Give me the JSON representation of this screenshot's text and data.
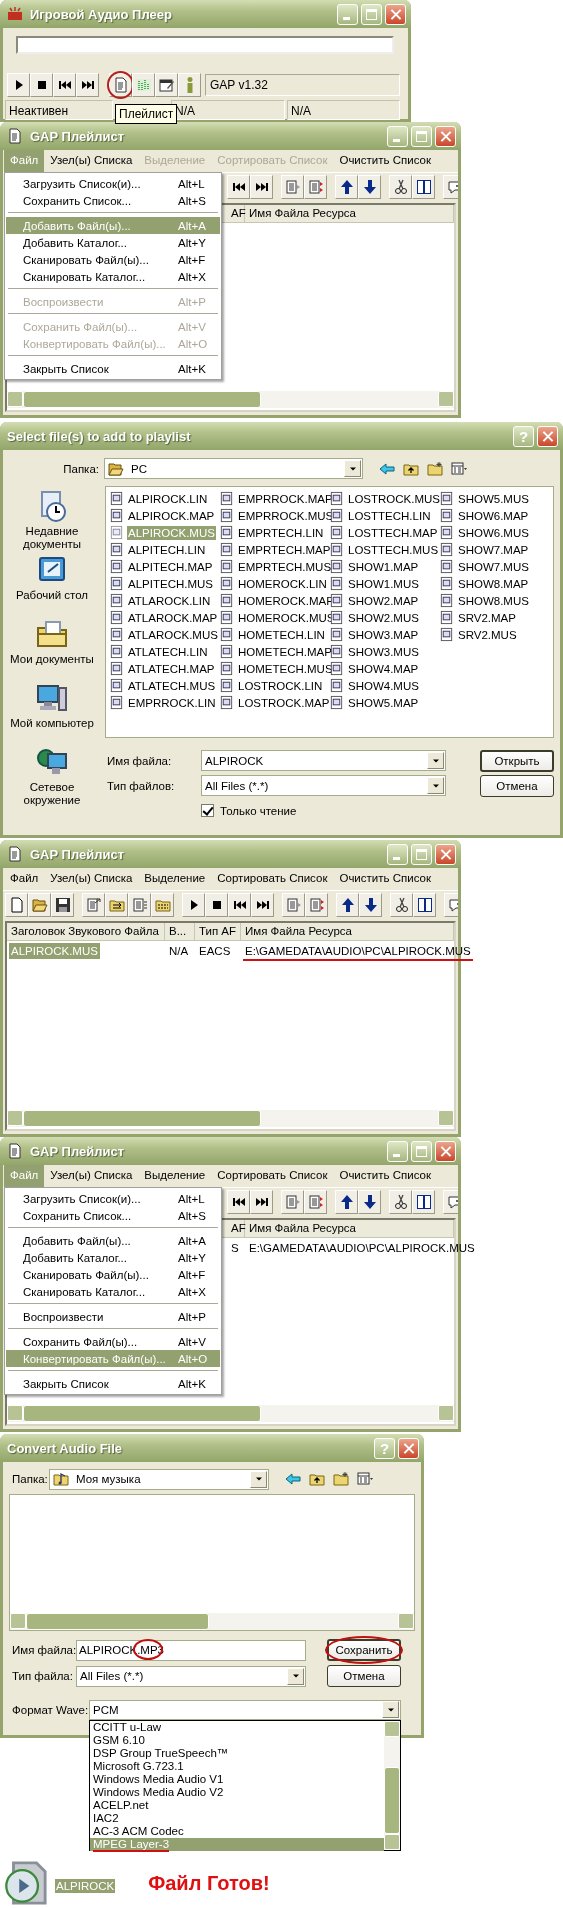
{
  "screens": [
    {
      "kind": "player",
      "title": "Игровой Аудио Плеер",
      "buttons": [
        {
          "kind": "play",
          "annotated": false
        },
        {
          "kind": "stop",
          "annotated": false
        },
        {
          "kind": "prev",
          "annotated": false
        },
        {
          "kind": "next",
          "annotated": false
        },
        {
          "kind": "playlist",
          "annotated": true
        },
        {
          "kind": "eq",
          "annotated": false
        },
        {
          "kind": "settings",
          "annotated": false
        },
        {
          "kind": "info",
          "annotated": false
        }
      ],
      "version": "GAP v1.32",
      "status": [
        "Неактивен",
        "N/A",
        "N/A"
      ],
      "tooltip": "Плейлист"
    },
    {
      "kind": "playlist",
      "title": "GAP Плейлист",
      "menubar": [
        {
          "label": "Файл",
          "open": true,
          "disabled": false
        },
        {
          "label": "Узел(ы) Списка",
          "open": false,
          "disabled": false
        },
        {
          "label": "Выделение",
          "open": false,
          "disabled": true
        },
        {
          "label": "Сортировать Список",
          "open": false,
          "disabled": true
        },
        {
          "label": "Очистить Список",
          "open": false,
          "disabled": false
        }
      ],
      "menu": [
        {
          "kind": "item",
          "label": "Загрузить Список(и)...",
          "shortcut": "Alt+L",
          "disabled": false,
          "selected": false
        },
        {
          "kind": "item",
          "label": "Сохранить Список...",
          "shortcut": "Alt+S",
          "disabled": false,
          "selected": false
        },
        {
          "kind": "separator"
        },
        {
          "kind": "item",
          "label": "Добавить Файл(ы)...",
          "shortcut": "Alt+A",
          "disabled": false,
          "selected": true
        },
        {
          "kind": "item",
          "label": "Добавить Каталог...",
          "shortcut": "Alt+Y",
          "disabled": false,
          "selected": false
        },
        {
          "kind": "item",
          "label": "Сканировать Файл(ы)...",
          "shortcut": "Alt+F",
          "disabled": false,
          "selected": false
        },
        {
          "kind": "item",
          "label": "Сканировать Каталог...",
          "shortcut": "Alt+X",
          "disabled": false,
          "selected": false
        },
        {
          "kind": "separator"
        },
        {
          "kind": "item",
          "label": "Воспроизвести",
          "shortcut": "Alt+P",
          "disabled": true,
          "selected": false
        },
        {
          "kind": "separator"
        },
        {
          "kind": "item",
          "label": "Сохранить Файл(ы)...",
          "shortcut": "Alt+V",
          "disabled": true,
          "selected": false
        },
        {
          "kind": "item",
          "label": "Конвертировать Файл(ы)...",
          "shortcut": "Alt+O",
          "disabled": true,
          "selected": false
        },
        {
          "kind": "separator"
        },
        {
          "kind": "item",
          "label": "Закрыть Список",
          "shortcut": "Alt+K",
          "disabled": false,
          "selected": false
        }
      ],
      "columns": [
        {
          "label": "AF"
        },
        {
          "label": "Имя Файла Ресурса"
        }
      ]
    },
    {
      "kind": "file_dialog",
      "title": "Select file(s) to add to playlist",
      "help": "?",
      "folder_label": "Папка:",
      "folder": "PC",
      "places": [
        {
          "kind": "recent",
          "label": "Недавние документы"
        },
        {
          "kind": "desktop",
          "label": "Рабочий стол"
        },
        {
          "kind": "documents",
          "label": "Мои документы"
        },
        {
          "kind": "computer",
          "label": "Мой компьютер"
        },
        {
          "kind": "network",
          "label": "Сетевое окружение"
        }
      ],
      "files": [
        {
          "name": "ALPIROCK.LIN",
          "selected": false
        },
        {
          "name": "ALPIROCK.MAP",
          "selected": false
        },
        {
          "name": "ALPIROCK.MUS",
          "selected": true
        },
        {
          "name": "ALPITECH.LIN",
          "selected": false
        },
        {
          "name": "ALPITECH.MAP",
          "selected": false
        },
        {
          "name": "ALPITECH.MUS",
          "selected": false
        },
        {
          "name": "ATLAROCK.LIN",
          "selected": false
        },
        {
          "name": "ATLAROCK.MAP",
          "selected": false
        },
        {
          "name": "ATLAROCK.MUS",
          "selected": false
        },
        {
          "name": "ATLATECH.LIN",
          "selected": false
        },
        {
          "name": "ATLATECH.MAP",
          "selected": false
        },
        {
          "name": "ATLATECH.MUS",
          "selected": false
        },
        {
          "name": "EMPRROCK.LIN",
          "selected": false
        },
        {
          "name": "EMPRROCK.MAP",
          "selected": false
        },
        {
          "name": "EMPRROCK.MUS",
          "selected": false
        },
        {
          "name": "EMPRTECH.LIN",
          "selected": false
        },
        {
          "name": "EMPRTECH.MAP",
          "selected": false
        },
        {
          "name": "EMPRTECH.MUS",
          "selected": false
        },
        {
          "name": "HOMEROCK.LIN",
          "selected": false
        },
        {
          "name": "HOMEROCK.MAP",
          "selected": false
        },
        {
          "name": "HOMEROCK.MUS",
          "selected": false
        },
        {
          "name": "HOMETECH.LIN",
          "selected": false
        },
        {
          "name": "HOMETECH.MAP",
          "selected": false
        },
        {
          "name": "HOMETECH.MUS",
          "selected": false
        },
        {
          "name": "LOSTROCK.LIN",
          "selected": false
        },
        {
          "name": "LOSTROCK.MAP",
          "selected": false
        },
        {
          "name": "LOSTROCK.MUS",
          "selected": false
        },
        {
          "name": "LOSTTECH.LIN",
          "selected": false
        },
        {
          "name": "LOSTTECH.MAP",
          "selected": false
        },
        {
          "name": "LOSTTECH.MUS",
          "selected": false
        },
        {
          "name": "SHOW1.MAP",
          "selected": false
        },
        {
          "name": "SHOW1.MUS",
          "selected": false
        },
        {
          "name": "SHOW2.MAP",
          "selected": false
        },
        {
          "name": "SHOW2.MUS",
          "selected": false
        },
        {
          "name": "SHOW3.MAP",
          "selected": false
        },
        {
          "name": "SHOW3.MUS",
          "selected": false
        },
        {
          "name": "SHOW4.MAP",
          "selected": false
        },
        {
          "name": "SHOW4.MUS",
          "selected": false
        },
        {
          "name": "SHOW5.MAP",
          "selected": false
        },
        {
          "name": "SHOW5.MUS",
          "selected": false
        },
        {
          "name": "SHOW6.MAP",
          "selected": false
        },
        {
          "name": "SHOW6.MUS",
          "selected": false
        },
        {
          "name": "SHOW7.MAP",
          "selected": false
        },
        {
          "name": "SHOW7.MUS",
          "selected": false
        },
        {
          "name": "SHOW8.MAP",
          "selected": false
        },
        {
          "name": "SHOW8.MUS",
          "selected": false
        },
        {
          "name": "SRV2.MAP",
          "selected": false
        },
        {
          "name": "SRV2.MUS",
          "selected": false
        }
      ],
      "filename_label": "Имя файла:",
      "filename": "ALPIROCK",
      "filetype_label": "Тип файлов:",
      "filetype": "All Files (*.*)",
      "open_button": "Открыть",
      "cancel_button": "Отмена",
      "readonly": {
        "label": "Только чтение",
        "checked": true
      }
    },
    {
      "kind": "playlist",
      "title": "GAP Плейлист",
      "menubar": [
        {
          "label": "Файл",
          "open": false,
          "disabled": false
        },
        {
          "label": "Узел(ы) Списка",
          "open": false,
          "disabled": false
        },
        {
          "label": "Выделение",
          "open": false,
          "disabled": false
        },
        {
          "label": "Сортировать Список",
          "open": false,
          "disabled": false
        },
        {
          "label": "Очистить Список",
          "open": false,
          "disabled": false
        }
      ],
      "columns": [
        {
          "label": "Заголовок Звукового Файла"
        },
        {
          "label": "В..."
        },
        {
          "label": "Тип AF"
        },
        {
          "label": "Имя Файла Ресурса"
        }
      ],
      "rows": [
        {
          "selected": true,
          "cells": [
            {
              "text": "ALPIROCK.MUS",
              "annotated": false
            },
            {
              "text": "N/A",
              "annotated": false
            },
            {
              "text": "EACS",
              "annotated": false
            },
            {
              "text": "E:\\GAMEDATA\\AUDIO\\PC\\ALPIROCK.MUS",
              "annotated": true
            }
          ]
        }
      ]
    },
    {
      "kind": "playlist",
      "title": "GAP Плейлист",
      "menubar": [
        {
          "label": "Файл",
          "open": true,
          "disabled": false
        },
        {
          "label": "Узел(ы) Списка",
          "open": false,
          "disabled": false
        },
        {
          "label": "Выделение",
          "open": false,
          "disabled": false
        },
        {
          "label": "Сортировать Список",
          "open": false,
          "disabled": false
        },
        {
          "label": "Очистить Список",
          "open": false,
          "disabled": false
        }
      ],
      "menu": [
        {
          "kind": "item",
          "label": "Загрузить Список(и)...",
          "shortcut": "Alt+L",
          "disabled": false,
          "selected": false
        },
        {
          "kind": "item",
          "label": "Сохранить Список...",
          "shortcut": "Alt+S",
          "disabled": false,
          "selected": false
        },
        {
          "kind": "separator"
        },
        {
          "kind": "item",
          "label": "Добавить Файл(ы)...",
          "shortcut": "Alt+A",
          "disabled": false,
          "selected": false
        },
        {
          "kind": "item",
          "label": "Добавить Каталог...",
          "shortcut": "Alt+Y",
          "disabled": false,
          "selected": false
        },
        {
          "kind": "item",
          "label": "Сканировать Файл(ы)...",
          "shortcut": "Alt+F",
          "disabled": false,
          "selected": false
        },
        {
          "kind": "item",
          "label": "Сканировать Каталог...",
          "shortcut": "Alt+X",
          "disabled": false,
          "selected": false
        },
        {
          "kind": "separator"
        },
        {
          "kind": "item",
          "label": "Воспроизвести",
          "shortcut": "Alt+P",
          "disabled": false,
          "selected": false
        },
        {
          "kind": "separator"
        },
        {
          "kind": "item",
          "label": "Сохранить Файл(ы)...",
          "shortcut": "Alt+V",
          "disabled": false,
          "selected": false
        },
        {
          "kind": "item",
          "label": "Конвертировать Файл(ы)...",
          "shortcut": "Alt+O",
          "disabled": false,
          "selected": true
        },
        {
          "kind": "separator"
        },
        {
          "kind": "item",
          "label": "Закрыть Список",
          "shortcut": "Alt+K",
          "disabled": false,
          "selected": false
        }
      ],
      "columns": [
        {
          "label": "AF"
        },
        {
          "label": "Имя Файла Ресурса"
        }
      ],
      "rows": [
        {
          "selected": false,
          "cells": [
            {
              "text": "S",
              "annotated": false
            },
            {
              "text": "E:\\GAMEDATA\\AUDIO\\PC\\ALPIROCK.MUS",
              "annotated": false
            }
          ]
        }
      ]
    },
    {
      "kind": "convert_dialog",
      "title": "Convert Audio File",
      "help": "?",
      "folder_label": "Папка:",
      "folder": "Моя музыка",
      "filename_label": "Имя файла:",
      "filename": {
        "value": "ALPIROCK.MP3",
        "annotated": true
      },
      "save_button": {
        "label": "Сохранить",
        "annotated": true
      },
      "filetype_label": "Тип файла:",
      "filetype": "All Files (*.*)",
      "cancel_button": "Отмена",
      "format_label": "Формат Wave:",
      "format": "PCM",
      "format_options": [
        {
          "label": "CCITT u-Law",
          "selected": false,
          "annotated": false
        },
        {
          "label": "GSM 6.10",
          "selected": false,
          "annotated": false
        },
        {
          "label": "DSP Group TrueSpeech™",
          "selected": false,
          "annotated": false
        },
        {
          "label": "Microsoft G.723.1",
          "selected": false,
          "annotated": false
        },
        {
          "label": "Windows Media Audio V1",
          "selected": false,
          "annotated": false
        },
        {
          "label": "Windows Media Audio V2",
          "selected": false,
          "annotated": false
        },
        {
          "label": "ACELP.net",
          "selected": false,
          "annotated": false
        },
        {
          "label": "IAC2",
          "selected": false,
          "annotated": false
        },
        {
          "label": "AC-3 ACM Codec",
          "selected": false,
          "annotated": false
        },
        {
          "label": "MPEG Layer-3",
          "selected": true,
          "annotated": true
        }
      ]
    },
    {
      "kind": "result",
      "file": {
        "label": "ALPIROCK",
        "selected": true
      },
      "message": "Файл Готов!"
    }
  ]
}
